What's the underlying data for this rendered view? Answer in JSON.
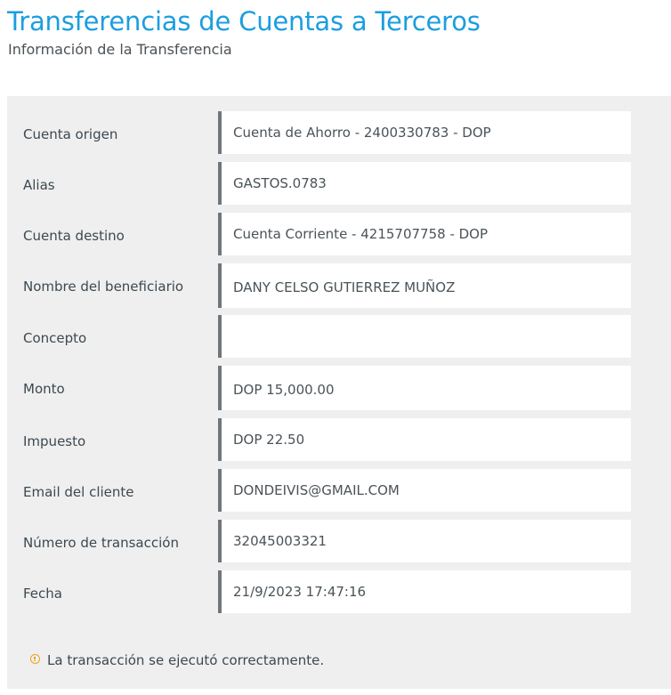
{
  "header": {
    "title": "Transferencias de Cuentas a Terceros",
    "subtitle": "Información de la Transferencia"
  },
  "details": {
    "rows": [
      {
        "label": "Cuenta origen",
        "value": "Cuenta de Ahorro - 2400330783 - DOP"
      },
      {
        "label": "Alias",
        "value": "GASTOS.0783"
      },
      {
        "label": "Cuenta destino",
        "value": "Cuenta Corriente - 4215707758 - DOP"
      },
      {
        "label": "Nombre del beneficiario",
        "value": "DANY CELSO GUTIERREZ MUÑOZ"
      },
      {
        "label": "Concepto",
        "value": ""
      },
      {
        "label": "Monto",
        "value": "DOP 15,000.00"
      },
      {
        "label": "Impuesto",
        "value": "DOP 22.50"
      },
      {
        "label": "Email del cliente",
        "value": "DONDEIVIS@GMAIL.COM"
      },
      {
        "label": "Número de transacción",
        "value": "32045003321"
      },
      {
        "label": "Fecha",
        "value": "21/9/2023 17:47:16"
      }
    ]
  },
  "notice": {
    "icon": "info-icon",
    "text": "La transacción se ejecutó correctamente.",
    "icon_color": "#f0a020"
  },
  "colors": {
    "title": "#1a9ee0",
    "panel_background": "#efefef",
    "field_border": "#6f767b"
  }
}
